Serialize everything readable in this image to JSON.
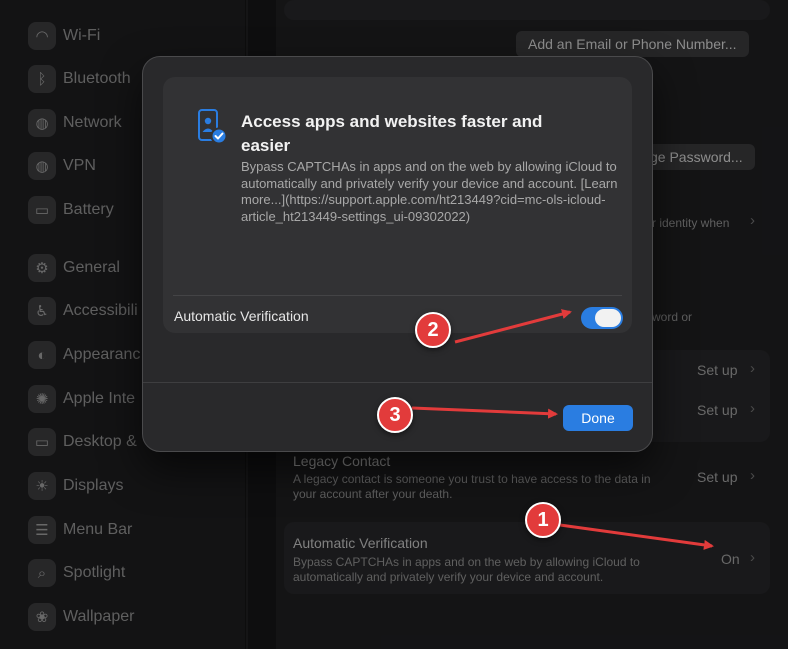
{
  "sidebar": {
    "items": [
      {
        "label": "Wi-Fi",
        "icon": "wifi-icon",
        "glyph": "◠"
      },
      {
        "label": "Bluetooth",
        "icon": "bluetooth-icon",
        "glyph": "ᛒ"
      },
      {
        "label": "Network",
        "icon": "network-icon",
        "glyph": "◍"
      },
      {
        "label": "VPN",
        "icon": "vpn-icon",
        "glyph": "◍"
      },
      {
        "label": "Battery",
        "icon": "battery-icon",
        "glyph": "▭"
      },
      {
        "label": "General",
        "icon": "gear-icon",
        "glyph": "⚙"
      },
      {
        "label": "Accessibili",
        "icon": "accessibility-icon",
        "glyph": "♿"
      },
      {
        "label": "Appearanc",
        "icon": "appearance-icon",
        "glyph": "◐"
      },
      {
        "label": "Apple Inte",
        "icon": "apple-intelligence-icon",
        "glyph": "✺"
      },
      {
        "label": "Desktop &",
        "icon": "desktop-icon",
        "glyph": "▭"
      },
      {
        "label": "Displays",
        "icon": "displays-icon",
        "glyph": "☀"
      },
      {
        "label": "Menu Bar",
        "icon": "menu-bar-icon",
        "glyph": "☰"
      },
      {
        "label": "Spotlight",
        "icon": "spotlight-icon",
        "glyph": "⌕"
      },
      {
        "label": "Wallpaper",
        "icon": "wallpaper-icon",
        "glyph": "❀"
      }
    ]
  },
  "main": {
    "add_email_button": "Add an Email or Phone Number...",
    "change_password_button": "ge Password...",
    "identity_text": "r identity when",
    "word_or_text": "word or",
    "setup_label": "Set up",
    "legacy": {
      "title": "Legacy Contact",
      "desc_line1": "A legacy contact is someone you trust to have access to the data in",
      "desc_line2": "your account after your death.",
      "action": "Set up"
    },
    "auto_verification": {
      "title": "Automatic Verification",
      "desc_line1": "Bypass CAPTCHAs in apps and on the web by allowing iCloud to",
      "desc_line2": "automatically and privately verify your device and account.",
      "value": "On"
    }
  },
  "sheet": {
    "title": "Access apps and websites faster and easier",
    "description": "Bypass CAPTCHAs in apps and on the web by allowing iCloud to automatically and privately verify your device and account. [Learn more...](https://support.apple.com/ht213449?cid=mc-ols-icloud-article_ht213449-settings_ui-09302022)",
    "toggle_label": "Automatic Verification",
    "toggle_on": true,
    "done_label": "Done"
  },
  "annotations": {
    "badge1": "1",
    "badge2": "2",
    "badge3": "3"
  },
  "colors": {
    "accent": "#2a7de1",
    "annotation": "#e23b3b"
  }
}
